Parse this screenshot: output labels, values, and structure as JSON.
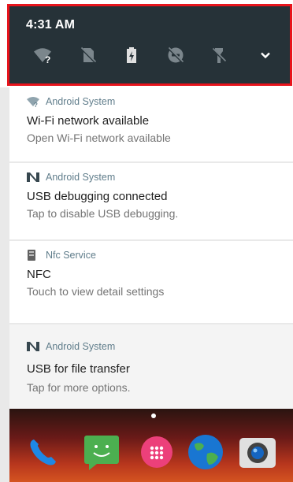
{
  "status": {
    "time": "4:31 AM",
    "quick_settings": [
      {
        "name": "wifi-unknown-icon"
      },
      {
        "name": "no-sim-icon"
      },
      {
        "name": "battery-charging-icon"
      },
      {
        "name": "do-not-disturb-off-icon"
      },
      {
        "name": "flashlight-off-icon"
      },
      {
        "name": "expand-chevron-icon"
      }
    ]
  },
  "notifications": [
    {
      "app": "Android System",
      "icon": "wifi-question-icon",
      "title": "Wi-Fi network available",
      "text": "Open Wi-Fi network available"
    },
    {
      "app": "Android System",
      "icon": "android-n-icon",
      "title": "USB debugging connected",
      "text": "Tap to disable USB debugging."
    },
    {
      "app": "Nfc Service",
      "icon": "nfc-device-icon",
      "title": "NFC",
      "text": "Touch to view detail settings"
    },
    {
      "app": "Android System",
      "icon": "android-n-icon",
      "title": "USB for file transfer",
      "text": "Tap for more options."
    }
  ],
  "dock": [
    {
      "name": "phone-app-icon"
    },
    {
      "name": "messaging-app-icon"
    },
    {
      "name": "app-drawer-icon"
    },
    {
      "name": "browser-app-icon"
    },
    {
      "name": "camera-app-icon"
    }
  ],
  "colors": {
    "header_bg": "#263238",
    "highlight": "#e8141c",
    "app_name": "#607d8b"
  }
}
